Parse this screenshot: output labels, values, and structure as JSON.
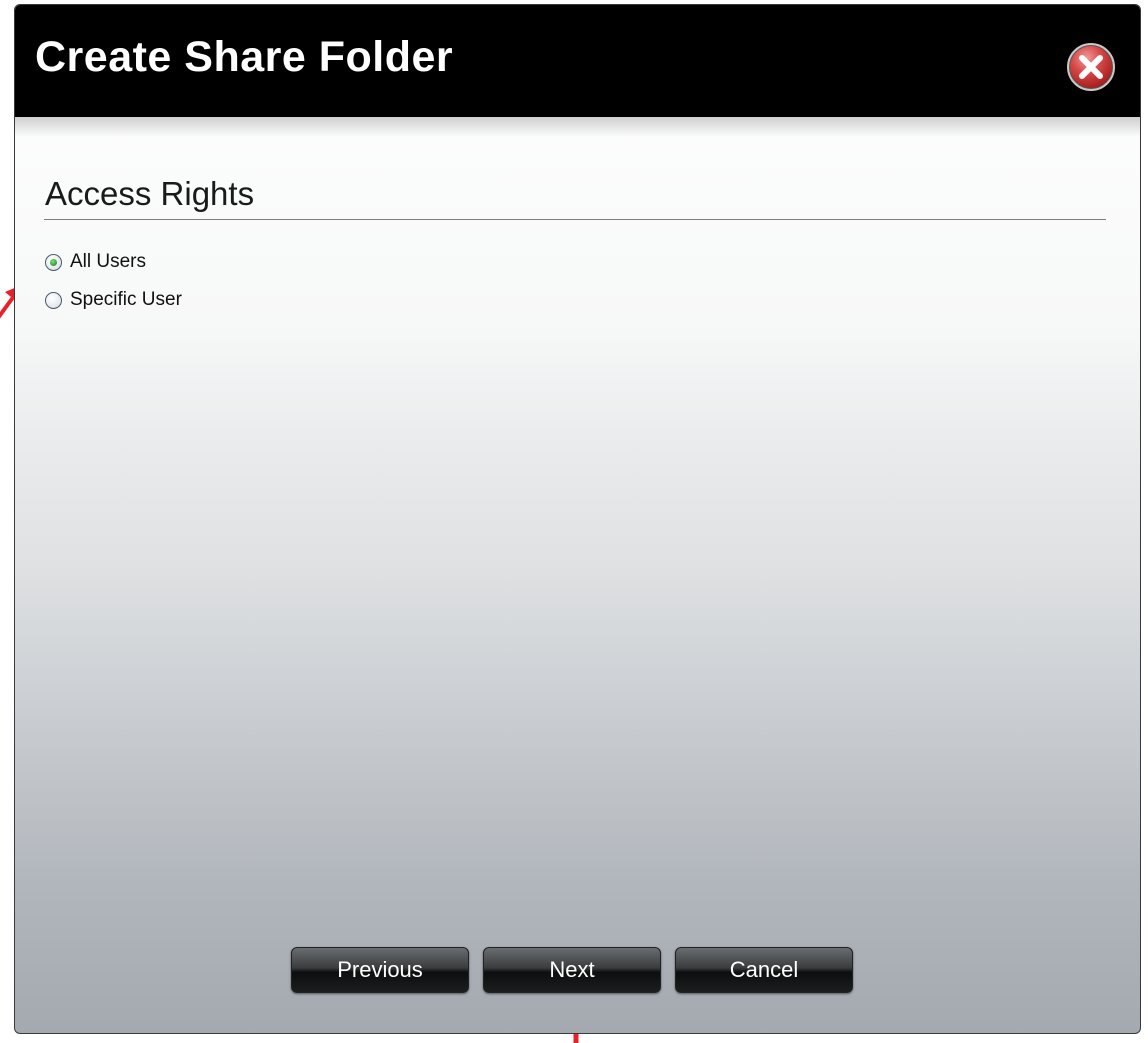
{
  "dialog": {
    "title": "Create Share Folder",
    "close_icon": "close-x-icon"
  },
  "section": {
    "title": "Access Rights"
  },
  "options": [
    {
      "label": "All Users",
      "checked": true
    },
    {
      "label": "Specific User",
      "checked": false
    }
  ],
  "buttons": {
    "previous": "Previous",
    "next": "Next",
    "cancel": "Cancel"
  },
  "colors": {
    "title_bar": "#000000",
    "annotation_arrow": "#e8202a",
    "radio_selected": "#2f9a2f"
  }
}
